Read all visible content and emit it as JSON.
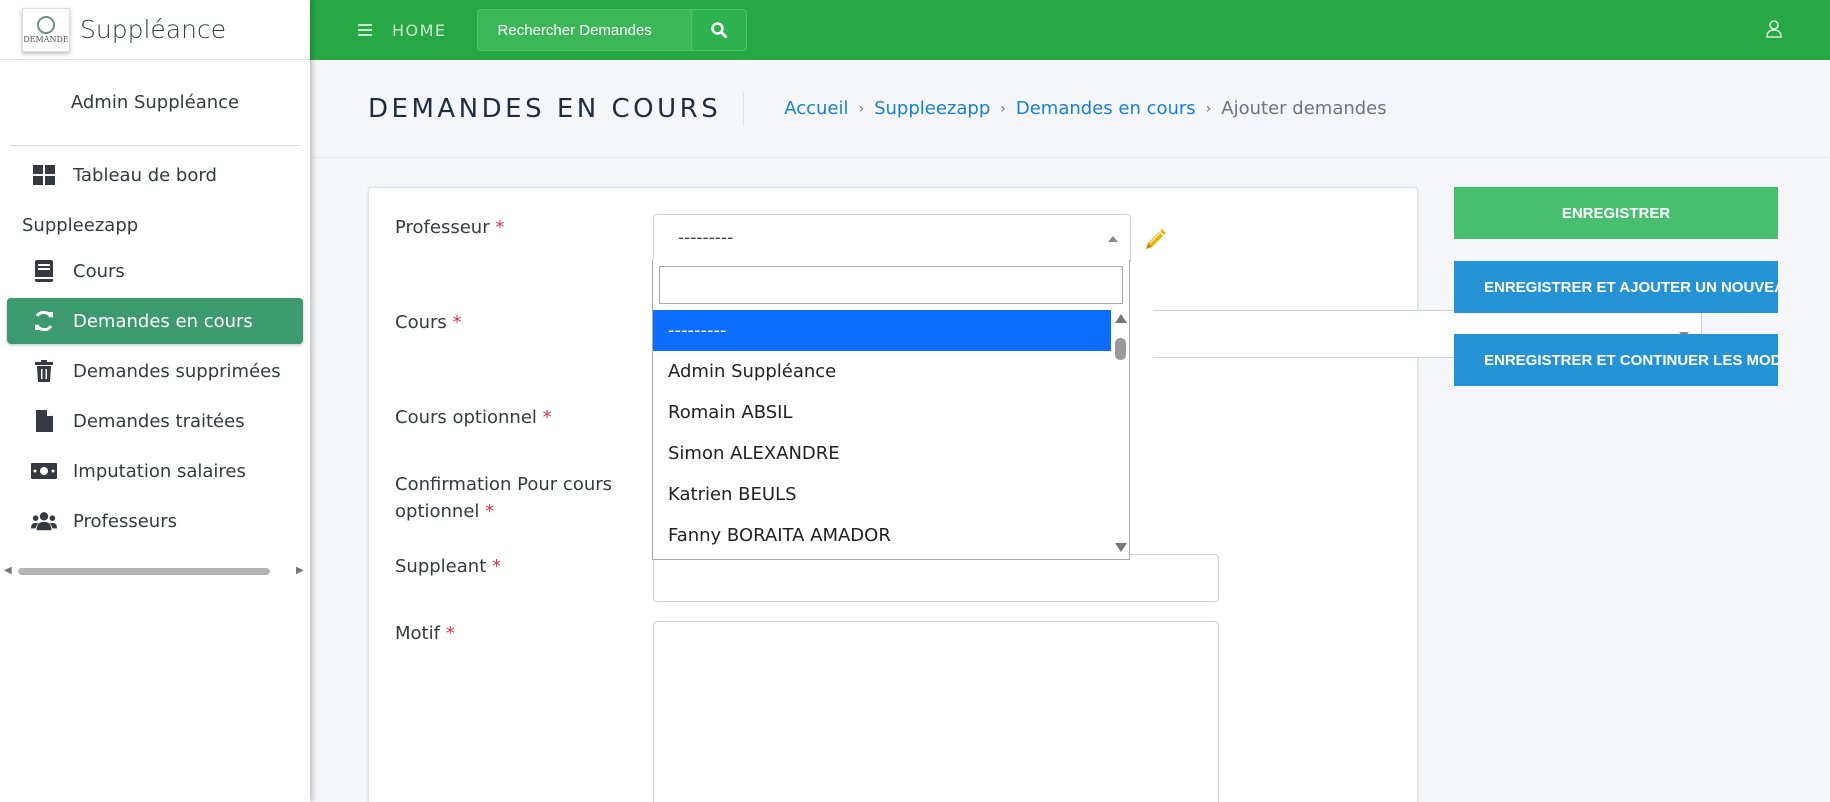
{
  "app": {
    "title": "Suppléance",
    "logo_text": "DEMANDE"
  },
  "sidebar": {
    "user_name": "Admin Suppléance",
    "items": [
      {
        "label": "Tableau de bord",
        "icon": "dashboard-icon"
      },
      {
        "label": "Cours",
        "icon": "book-icon"
      },
      {
        "label": "Demandes en cours",
        "icon": "sync-icon",
        "active": true
      },
      {
        "label": "Demandes supprimées",
        "icon": "trash-icon"
      },
      {
        "label": "Demandes traitées",
        "icon": "file-icon"
      },
      {
        "label": "Imputation salaires",
        "icon": "money-icon"
      },
      {
        "label": "Professeurs",
        "icon": "users-icon"
      }
    ],
    "section_header": "Suppleezapp"
  },
  "topbar": {
    "home_label": "HOME",
    "search_placeholder": "Rechercher Demandes"
  },
  "header": {
    "page_title": "DEMANDES EN COURS",
    "breadcrumb": [
      "Accueil",
      "Suppleezapp",
      "Demandes en cours",
      "Ajouter demandes"
    ]
  },
  "form": {
    "professeur_label": "Professeur",
    "cours_label": "Cours",
    "cours_optionnel_label": "Cours optionnel",
    "confirmation_label_1": "Confirmation Pour cours",
    "confirmation_label_2": "optionnel",
    "suppleant_label": "Suppleant",
    "motif_label": "Motif",
    "required_marker": "*",
    "professeur_value": "---------"
  },
  "dropdown": {
    "options": [
      "---------",
      "Admin Suppléance",
      "Romain ABSIL",
      "Simon ALEXANDRE",
      "Katrien BEULS",
      "Fanny BORAITA AMADOR"
    ],
    "selected_index": 0
  },
  "actions": {
    "save": "ENREGISTRER",
    "save_add": "ENREGISTRER ET AJOUTER UN NOUVEAU",
    "save_continue": "ENREGISTRER ET CONTINUER LES MODIFICATIONS"
  },
  "colors": {
    "topbar": "#28a745",
    "active_nav": "#3d9970",
    "save_button": "#48bf6e",
    "secondary_buttons": "#2592d6",
    "dropdown_selected": "#0d6efd",
    "link": "#1a7fd6",
    "required": "#dc3545"
  }
}
